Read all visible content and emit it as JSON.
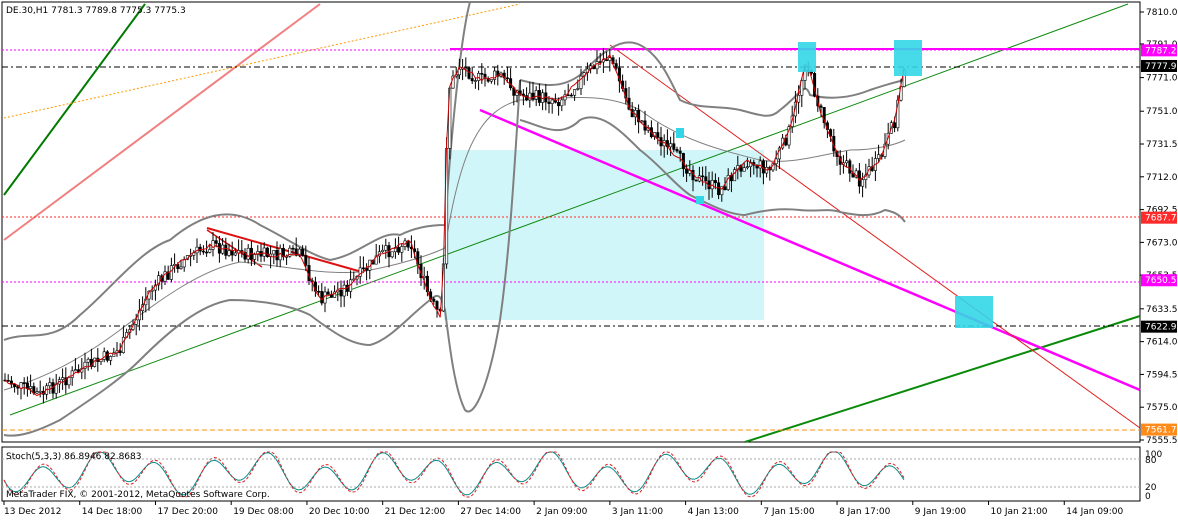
{
  "window": {
    "symbol_info": "DE.30,H1  7781.3  7789.8  7775.3  7775.3",
    "copyright": "MetaTrader FIX, © 2001-2012, MetaQuotes Software Corp."
  },
  "indicator": {
    "label": "Stoch(5,3,3) 86.8946 82.8683",
    "levels": [
      "100",
      "80",
      "20",
      "0"
    ]
  },
  "price_axis": {
    "ticks": [
      "7810.0",
      "7791.0",
      "7771.0",
      "7751.0",
      "7731.5",
      "7712.0",
      "7692.5",
      "7673.0",
      "7653.5",
      "7633.5",
      "7614.0",
      "7594.5",
      "7575.0",
      "7555.5"
    ],
    "tags": [
      {
        "text": "7787.2",
        "bg": "#ff00ff",
        "fg": "#ffffff",
        "value": 7787.2
      },
      {
        "text": "7777.9",
        "bg": "#000000",
        "fg": "#ffffff",
        "value": 7777.9
      },
      {
        "text": "7687.7",
        "bg": "#ff2a2a",
        "fg": "#ffffff",
        "value": 7687.7
      },
      {
        "text": "7650.5",
        "bg": "#ff00ff",
        "fg": "#ffffff",
        "value": 7650.5
      },
      {
        "text": "7622.9",
        "bg": "#000000",
        "fg": "#ffffff",
        "value": 7622.9
      },
      {
        "text": "7561.7",
        "bg": "#ff8c1a",
        "fg": "#ffffff",
        "value": 7561.7
      }
    ]
  },
  "time_axis": {
    "ticks": [
      "13 Dec 2012",
      "14 Dec 18:00",
      "17 Dec 20:00",
      "19 Dec 08:00",
      "20 Dec 10:00",
      "21 Dec 12:00",
      "27 Dec 14:00",
      "2 Jan 09:00",
      "3 Jan 11:00",
      "4 Jan 13:00",
      "7 Jan 15:00",
      "8 Jan 17:00",
      "9 Jan 19:00",
      "10 Jan 21:00",
      "14 Jan 09:00"
    ]
  },
  "colors": {
    "magenta": "#ff00ff",
    "dark_green": "#007a00",
    "green_thin": "#108a10",
    "red": "#dd1111",
    "salmon": "#f08080",
    "orange": "#ff9900",
    "cyan_zone": "#c8f5f8",
    "cyan_box": "#33d6e6",
    "band": "#808080",
    "candle": "#000000",
    "grid_black": "#000000"
  }
}
